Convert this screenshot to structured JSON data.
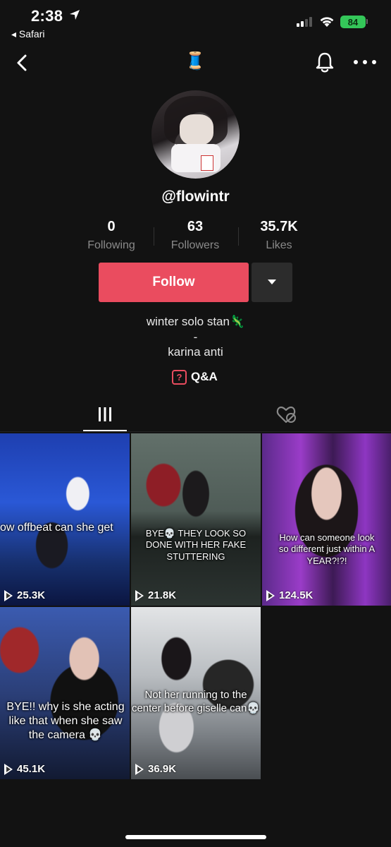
{
  "status_bar": {
    "time": "2:38",
    "back_app": "◂ Safari",
    "battery": "84"
  },
  "nav": {
    "title_emoji": "🧵",
    "back_icon": "chevron-left-icon",
    "bell_icon": "bell-icon",
    "more_icon": "more-icon"
  },
  "profile": {
    "username": "@flowintr",
    "stats": [
      {
        "value": "0",
        "label": "Following"
      },
      {
        "value": "63",
        "label": "Followers"
      },
      {
        "value": "35.7K",
        "label": "Likes"
      }
    ],
    "follow_label": "Follow",
    "bio_line1": "winter solo stan🦎",
    "bio_line2": "-",
    "bio_line3": "karina anti",
    "qa_icon_text": "?",
    "qa_label": "Q&A"
  },
  "colors": {
    "background": "#121212",
    "accent": "#ea4c5f",
    "muted_text": "#8a8a8a"
  },
  "videos": [
    {
      "caption": "ow offbeat can she get",
      "views": "25.3K"
    },
    {
      "caption": "BYE💀 THEY LOOK SO DONE WITH HER FAKE STUTTERING",
      "views": "21.8K"
    },
    {
      "caption": "How can someone look so different just within A YEAR?!?!",
      "views": "124.5K"
    },
    {
      "caption": "BYE!! why is she acting like that when she saw the camera 💀",
      "views": "45.1K"
    },
    {
      "caption": "Not her running to the center before giselle can💀",
      "views": "36.9K"
    }
  ]
}
